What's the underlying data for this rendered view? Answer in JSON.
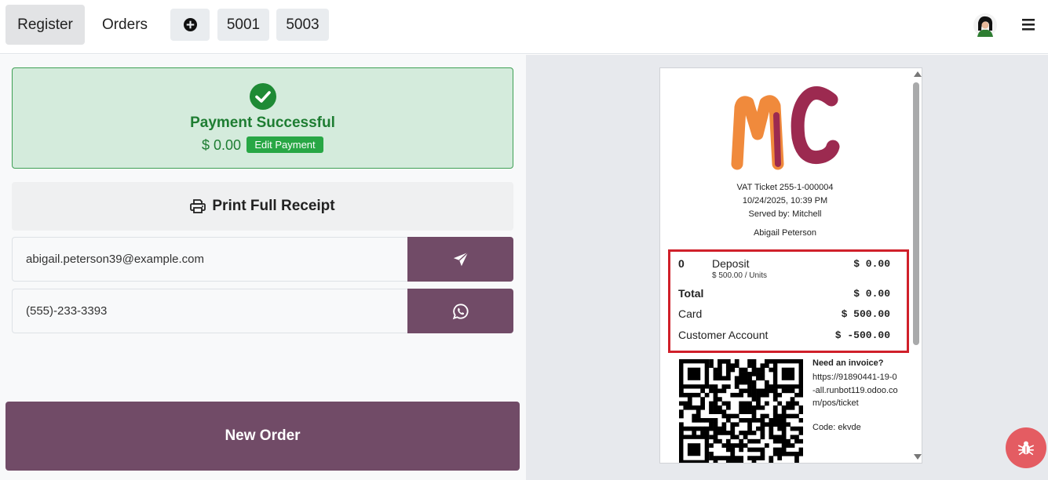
{
  "header": {
    "tabs": [
      {
        "label": "Register",
        "active": true
      },
      {
        "label": "Orders",
        "active": false
      }
    ],
    "order_tabs": [
      "5001",
      "5003"
    ],
    "add_icon": "plus-circle-icon",
    "menu_icon": "hamburger-icon"
  },
  "payment": {
    "status_icon": "check-circle-icon",
    "title": "Payment Successful",
    "amount": "$ 0.00",
    "edit_label": "Edit Payment",
    "print_label": "Print Full Receipt",
    "email_value": "abigail.peterson39@example.com",
    "phone_value": "(555)-233-3393",
    "new_order_label": "New Order"
  },
  "receipt": {
    "ticket": "VAT Ticket 255-1-000004",
    "date": "10/24/2025, 10:39 PM",
    "served_by": "Served by: Mitchell",
    "customer": "Abigail Peterson",
    "line": {
      "qty": "0",
      "name": "Deposit",
      "detail": "$ 500.00 / Units",
      "amount": "$ 0.00"
    },
    "total_label": "Total",
    "total_amount": "$ 0.00",
    "payments": [
      {
        "label": "Card",
        "amount": "$ 500.00"
      },
      {
        "label": "Customer Account",
        "amount": "$ -500.00"
      }
    ],
    "invoice_title": "Need an invoice?",
    "invoice_url": "https://91890441-19-0-all.runbot119.odoo.com/pos/ticket",
    "invoice_code": "Code: ekvde"
  },
  "colors": {
    "primary": "#714b67",
    "success": "#1e7d32",
    "success_bg": "#d4ebdc",
    "highlight": "#d0202a",
    "debug": "#e45c62"
  }
}
